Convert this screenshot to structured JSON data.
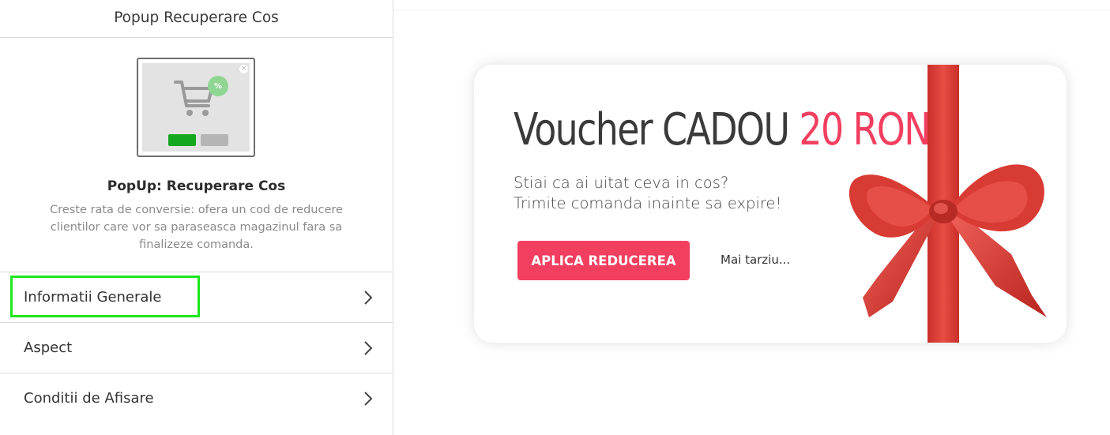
{
  "sidebar": {
    "title": "Popup Recuperare Cos",
    "thumbnail": {
      "close_glyph": "×",
      "badge": "%",
      "icons": [
        "cart-icon",
        "close-icon"
      ]
    },
    "description": {
      "title": "PopUp: Recuperare Cos",
      "text": "Creste rata de conversie: ofera un cod de reducere clientilor care vor sa paraseasca magazinul fara sa finalizeze comanda."
    },
    "menu": [
      {
        "label": "Informatii Generale",
        "highlighted": true
      },
      {
        "label": "Aspect"
      },
      {
        "label": "Conditii de Afisare"
      }
    ]
  },
  "preview": {
    "title_prefix": "Voucher CADOU",
    "title_amount": "20 RON",
    "line1": "Stiai ca ai uitat ceva in cos?",
    "line2": "Trimite comanda inainte sa expire!",
    "apply_button": "APLICA REDUCEREA",
    "later_link": "Mai tarziu..."
  },
  "colors": {
    "accent": "#f23f5f",
    "highlight": "#1ee61e",
    "ribbon": "#e2443c",
    "green_button": "#14a81e"
  }
}
